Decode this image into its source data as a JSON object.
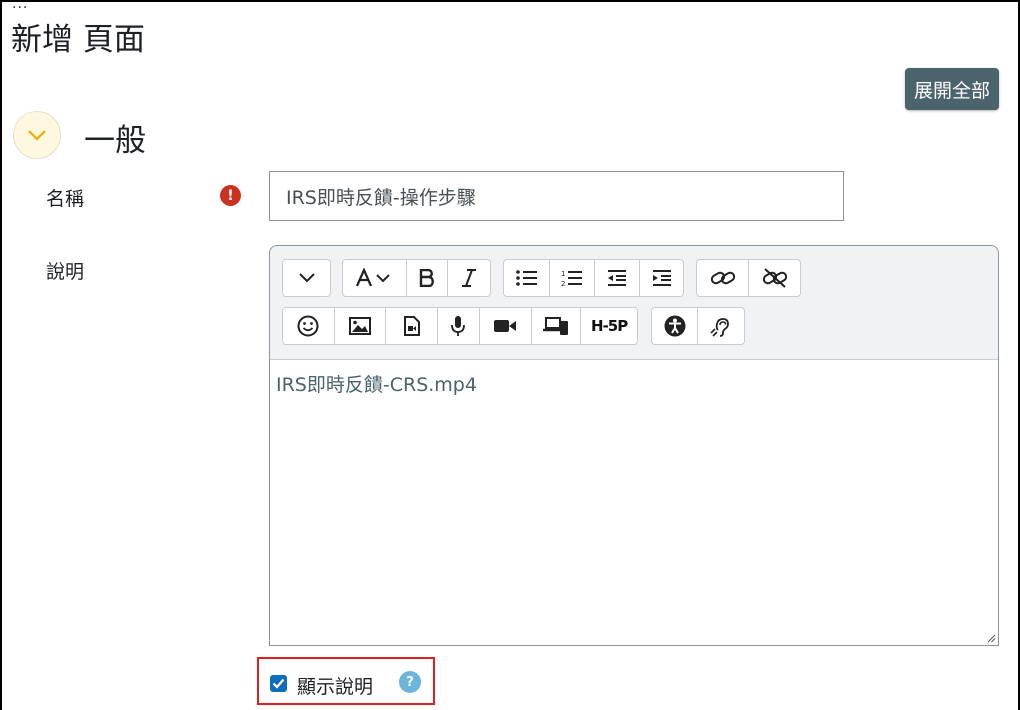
{
  "page": {
    "title": "新增 頁面",
    "dots": "..."
  },
  "header": {
    "expand_all_label": "展開全部"
  },
  "section": {
    "title": "一般"
  },
  "form": {
    "name_label": "名稱",
    "name_value": "IRS即時反饋-操作步驟",
    "required_icon": "!",
    "description_label": "說明",
    "description_content": "IRS即時反饋-CRS.mp4",
    "show_description_label": "顯示說明",
    "show_description_checked": true,
    "help_icon": "?"
  },
  "toolbar": {
    "h5p_label": "H-5P"
  },
  "colors": {
    "expand_button": "#4b636c",
    "required": "#ca3120",
    "checkbox": "#0f6cbf",
    "help": "#6cb5db",
    "highlight_border": "#e02020",
    "toggle_bg": "#fff8e1",
    "toggle_chevron": "#f0ad00"
  }
}
